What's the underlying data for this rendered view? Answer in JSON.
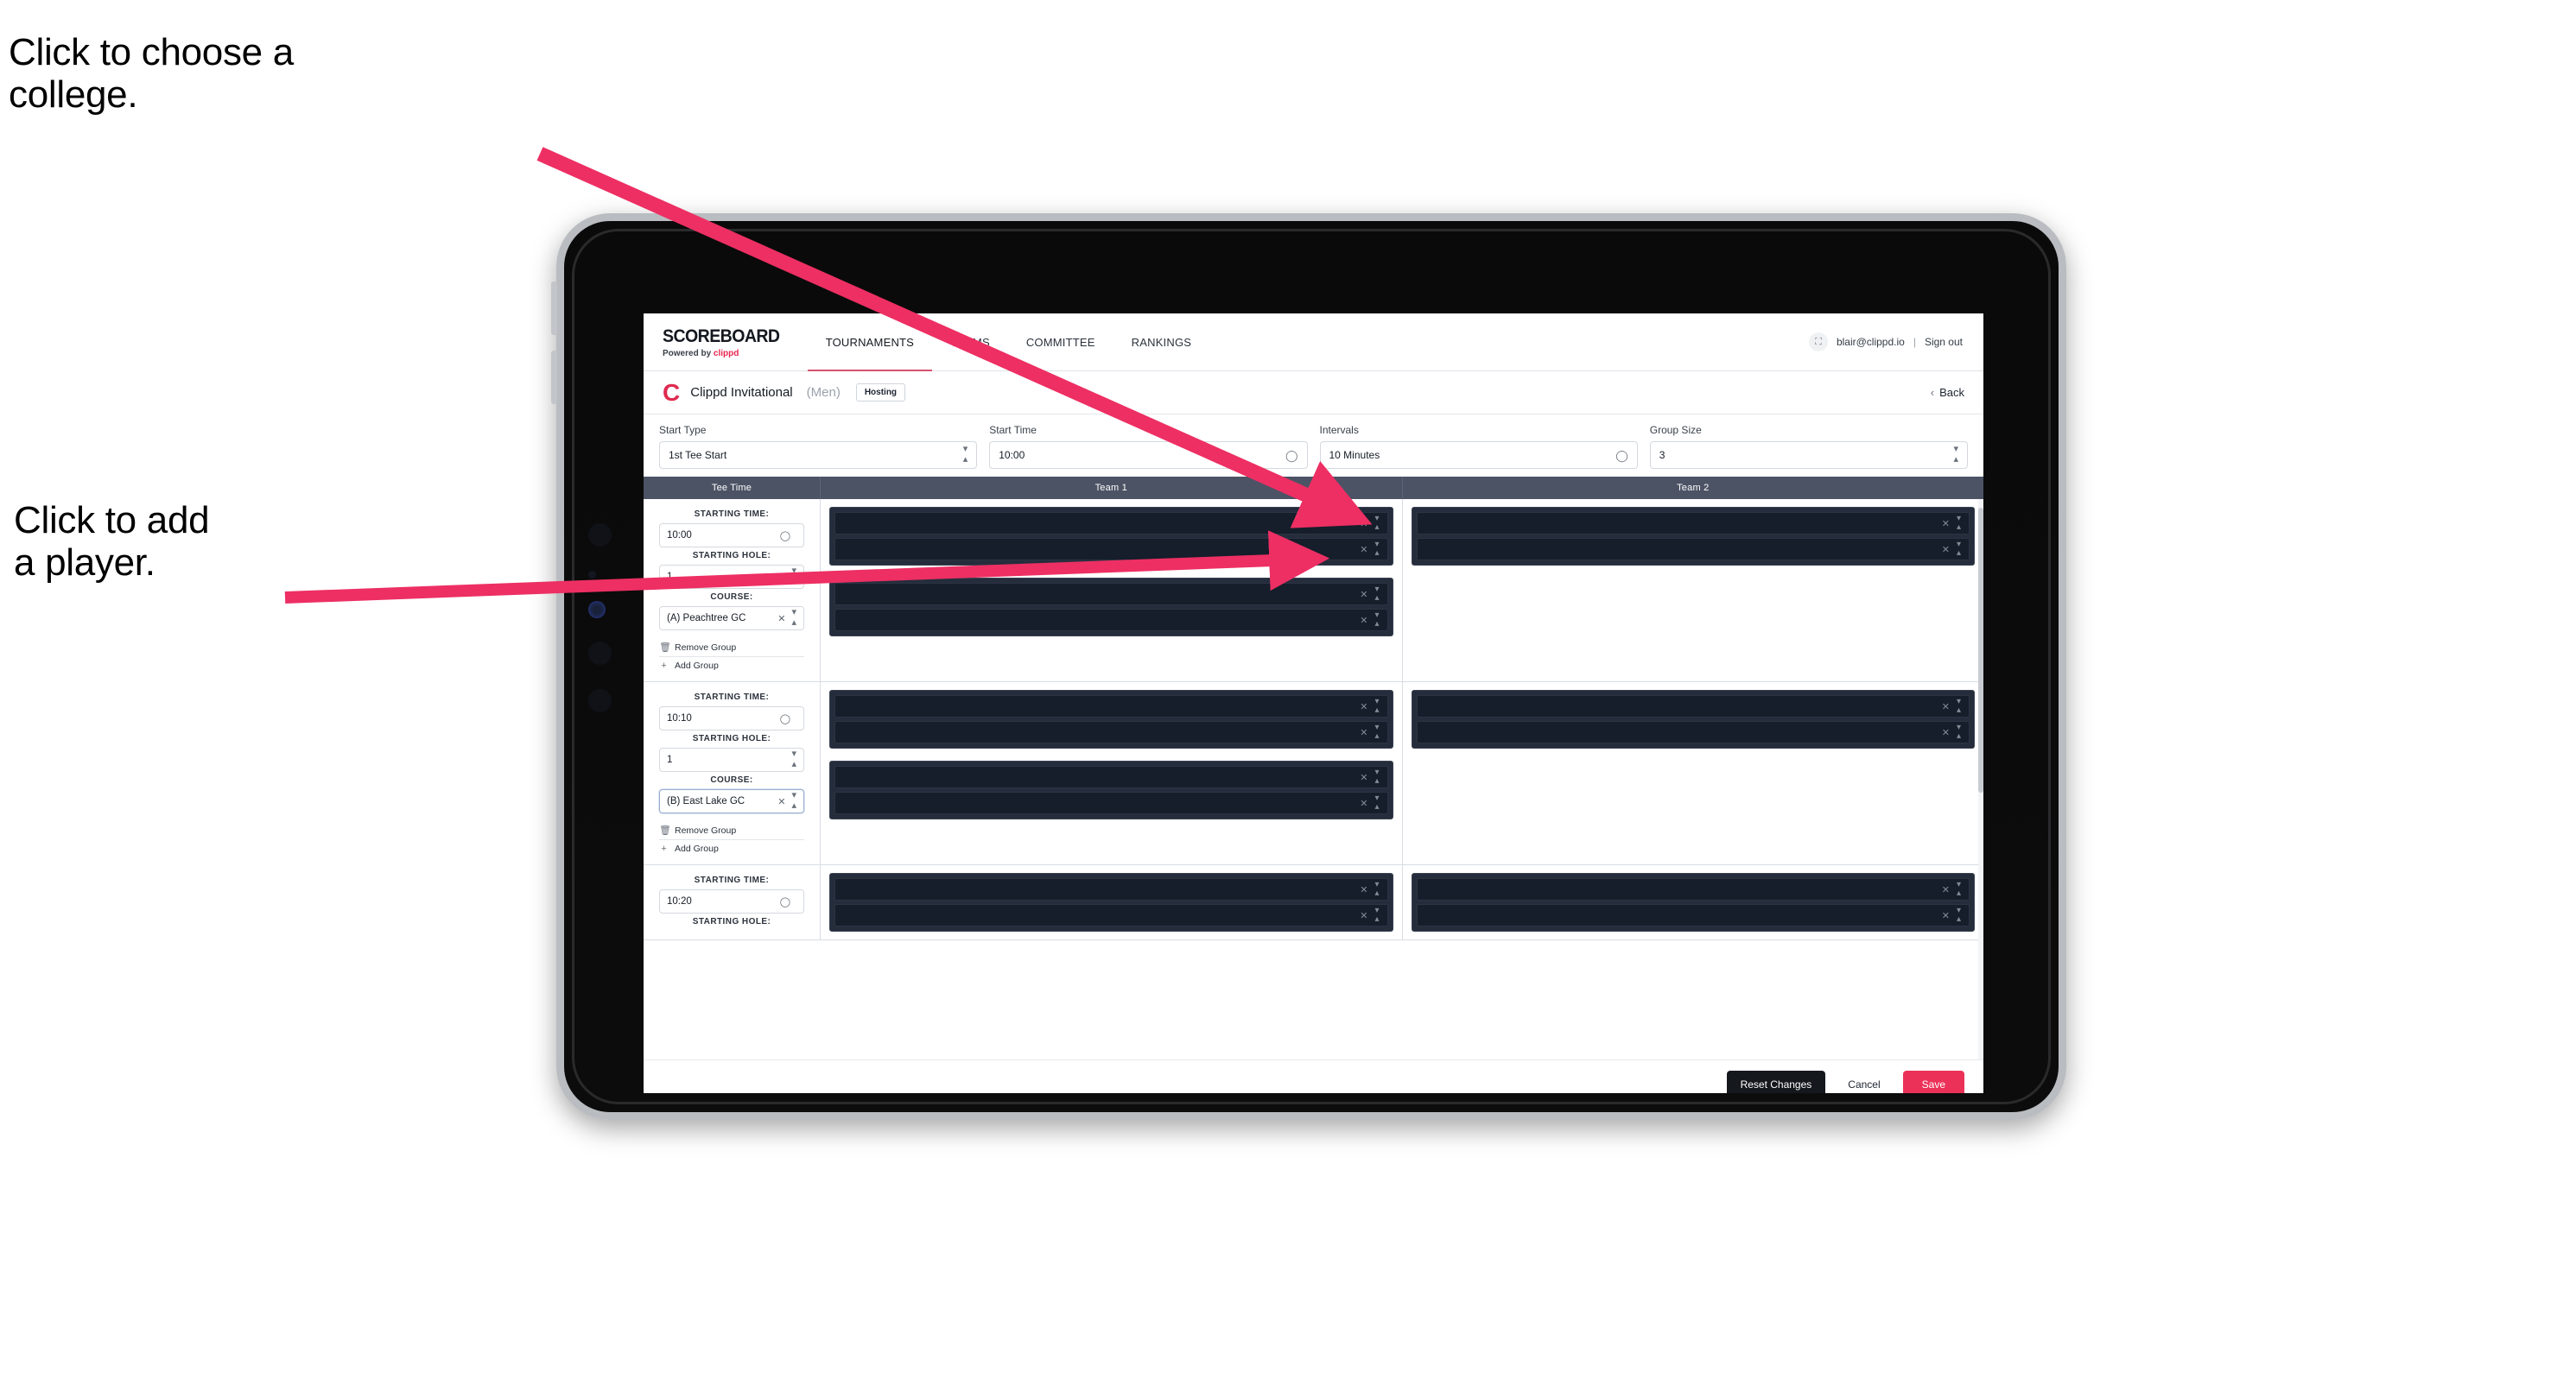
{
  "annotations": [
    {
      "id": "choose-college",
      "text": "Click to choose a\ncollege."
    },
    {
      "id": "add-player",
      "text": "Click to add\na player."
    }
  ],
  "colors": {
    "accent_pink": "#ec3158",
    "brand_red": "#e02a4f",
    "table_header": "#4c5365",
    "slot_outer": "#252d3c",
    "slot_inner": "#161d2b",
    "arrow": "#ed2f63"
  },
  "nav": {
    "brand_title": "SCOREBOARD",
    "brand_sub_prefix": "Powered by ",
    "brand_sub_mark": "clippd",
    "links": [
      {
        "label": "TOURNAMENTS",
        "active": true
      },
      {
        "label": "TEAMS",
        "active": false
      },
      {
        "label": "COMMITTEE",
        "active": false
      },
      {
        "label": "RANKINGS",
        "active": false
      }
    ],
    "avatar_icon": "user-avatar-icon",
    "user_email": "blair@clippd.io",
    "separator": "|",
    "sign_out": "Sign out"
  },
  "tournament_bar": {
    "logo_letter": "C",
    "name": "Clippd Invitational",
    "gender": "(Men)",
    "badge": "Hosting",
    "back_chevron": "‹",
    "back_label": "Back"
  },
  "form": {
    "fields": [
      {
        "label": "Start Type",
        "value": "1st Tee Start",
        "adorn": "stepper-icon"
      },
      {
        "label": "Start Time",
        "value": "10:00",
        "adorn": "clock-icon"
      },
      {
        "label": "Intervals",
        "value": "10 Minutes",
        "adorn": "clock-icon"
      },
      {
        "label": "Group Size",
        "value": "3",
        "adorn": "stepper-icon"
      }
    ]
  },
  "table": {
    "headers": {
      "tee_time": "Tee Time",
      "team_1": "Team 1",
      "team_2": "Team 2"
    },
    "labels": {
      "starting_time": "STARTING TIME:",
      "starting_hole": "STARTING HOLE:",
      "course": "COURSE:",
      "remove_group": "Remove Group",
      "add_group": "Add Group",
      "remove_icon": "trash-icon",
      "add_icon": "plus-icon",
      "clear_icon": "clear-x-icon",
      "stepper_icon": "stepper-icon",
      "clock_icon": "clock-icon"
    },
    "rows": [
      {
        "starting_time": "10:00",
        "starting_hole": "1",
        "course": "(A) Peachtree GC",
        "course_focused": false,
        "team1_groups": [
          2,
          2
        ],
        "team2_groups": [
          2
        ]
      },
      {
        "starting_time": "10:10",
        "starting_hole": "1",
        "course": "(B) East Lake GC",
        "course_focused": true,
        "team1_groups": [
          2,
          2
        ],
        "team2_groups": [
          2
        ]
      },
      {
        "starting_time": "10:20",
        "starting_hole": "",
        "course": "",
        "course_focused": false,
        "partial": true,
        "team1_groups": [
          2
        ],
        "team2_groups": [
          2
        ]
      }
    ]
  },
  "footer": {
    "reset": "Reset Changes",
    "cancel": "Cancel",
    "save": "Save"
  }
}
